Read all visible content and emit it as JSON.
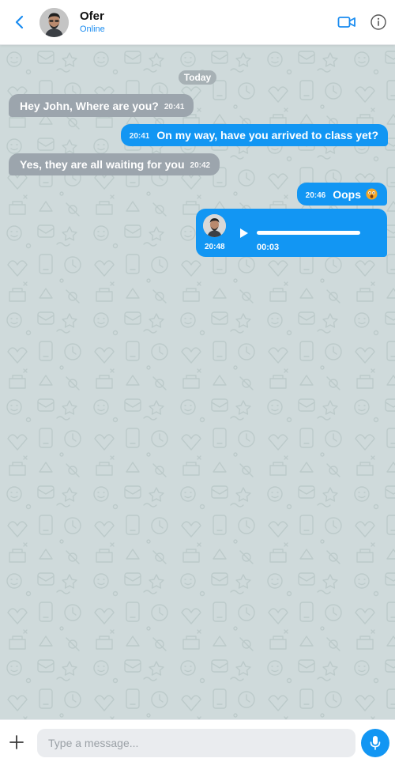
{
  "header": {
    "contact_name": "Ofer",
    "status": "Online",
    "icons": {
      "back": "chevron-left-icon",
      "video": "video-camera-icon",
      "info": "info-icon"
    }
  },
  "chat": {
    "date_label": "Today",
    "messages": [
      {
        "direction": "incoming",
        "text": "Hey John, Where are you?",
        "time": "20:41"
      },
      {
        "direction": "outgoing",
        "text": "On my way, have you arrived to class yet?",
        "time": "20:41"
      },
      {
        "direction": "incoming",
        "text": "Yes, they are all waiting for you",
        "time": "20:42"
      },
      {
        "direction": "outgoing",
        "text": "Oops",
        "time": "20:46",
        "emoji": "face-with-open-mouth-emoji"
      },
      {
        "direction": "outgoing",
        "type": "voice",
        "time": "20:48",
        "duration": "00:03"
      }
    ]
  },
  "composer": {
    "placeholder": "Type a message...",
    "value": ""
  },
  "colors": {
    "accent": "#1296f3",
    "incoming_bubble": "#9ca5ad",
    "chat_background": "#cfdadb",
    "status": "#1a8cf0"
  }
}
